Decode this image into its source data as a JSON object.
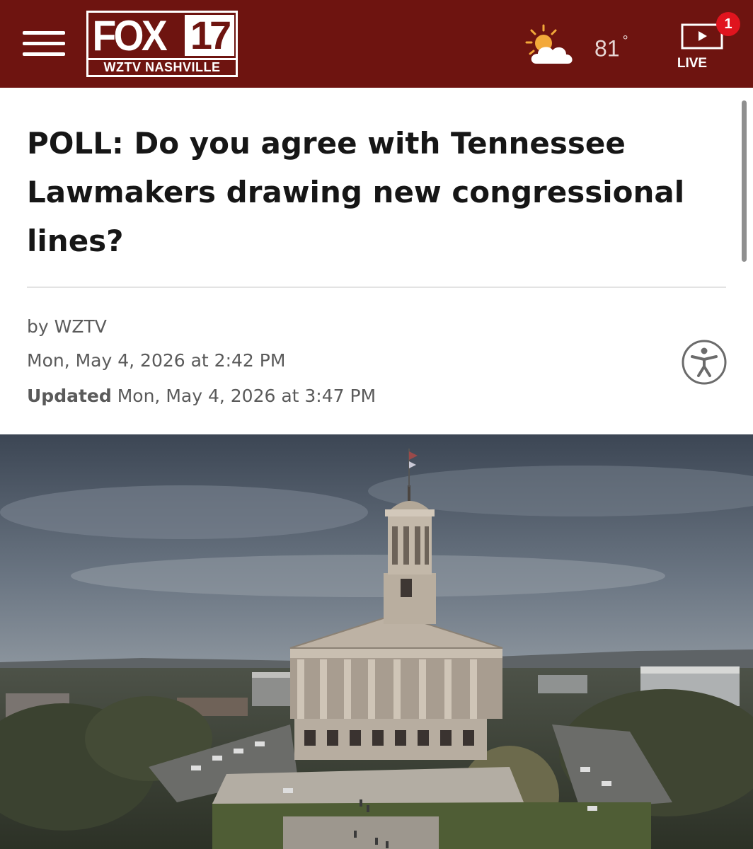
{
  "header": {
    "menu_icon": "hamburger-menu-icon",
    "logo": {
      "brand": "FOX",
      "number": "17",
      "subtitle": "WZTV NASHVILLE"
    },
    "weather": {
      "icon": "partly-sunny-icon",
      "temperature": "81",
      "unit_symbol": "°"
    },
    "live": {
      "icon": "live-video-icon",
      "badge_count": "1",
      "label": "LIVE"
    },
    "colors": {
      "bar": "#6e1410",
      "badge": "#e0141e",
      "sun": "#f3a93a"
    }
  },
  "article": {
    "headline": "POLL: Do you agree with Tennessee Lawmakers drawing new congressional lines?",
    "byline": "by WZTV",
    "published": "Mon, May 4, 2026 at 2:42 PM",
    "updated_label": "Updated",
    "updated": "Mon, May 4, 2026 at 3:47 PM",
    "accessibility_icon": "accessibility-person-icon"
  },
  "hero_image": {
    "subject": "tennessee-state-capitol-photo"
  }
}
